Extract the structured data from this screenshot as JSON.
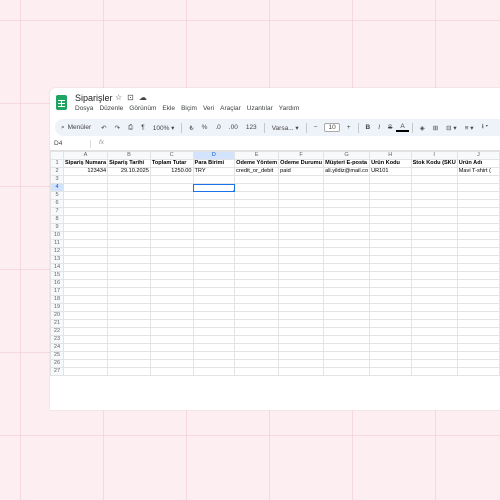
{
  "window": {
    "title": "Siparişler",
    "menu": [
      "Dosya",
      "Düzenle",
      "Görünüm",
      "Ekle",
      "Biçim",
      "Veri",
      "Araçlar",
      "Uzantılar",
      "Yardım"
    ]
  },
  "toolbar": {
    "search_label": "Menüler",
    "zoom": "100%",
    "currency": "₺",
    "percent": "%",
    "dec_decrease": ".0",
    "dec_increase": ".00",
    "format_123": "123",
    "font": "Varsa...",
    "font_minus": "−",
    "font_size": "10",
    "font_plus": "+",
    "bold": "B",
    "italic": "I",
    "strike": "S",
    "text_color": "A"
  },
  "formula_bar": {
    "cell_ref": "D4",
    "fx": "fx",
    "value": ""
  },
  "sheet": {
    "columns": [
      "A",
      "B",
      "C",
      "D",
      "E",
      "F",
      "G",
      "H",
      "I",
      "J"
    ],
    "active_column": "D",
    "active_row": 4,
    "rows": [
      [
        "Sipariş Numara",
        "Sipariş Tarihi",
        "Toplam Tutar",
        "Para Birimi",
        "Ödeme Yöntem",
        "Ödeme Durumu",
        "Müşteri E-posta",
        "Ürün Kodu",
        "Stok Kodu (SKU",
        "Ürün Adı"
      ],
      [
        "123434",
        "29.10.2025",
        "1250.00",
        "TRY",
        "credit_or_debit",
        "paid",
        "ali.yildiz@mail.co",
        "UR101",
        "",
        "Mavi T-shirt ("
      ]
    ],
    "row_count": 27
  },
  "colors": {
    "accent": "#1a73e8",
    "sheets_green": "#1fa463",
    "background": "#fdeef1"
  }
}
